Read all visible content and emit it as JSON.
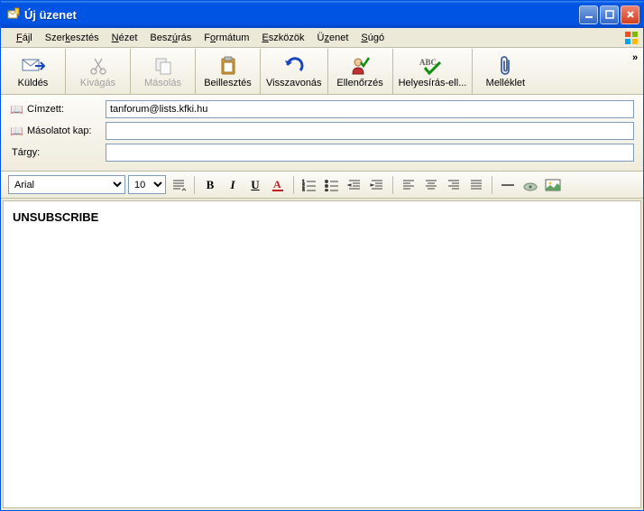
{
  "window": {
    "title": "Új üzenet"
  },
  "menu": {
    "items": [
      {
        "pre": "",
        "hot": "F",
        "post": "ájl"
      },
      {
        "pre": "Szer",
        "hot": "k",
        "post": "esztés"
      },
      {
        "pre": "",
        "hot": "N",
        "post": "ézet"
      },
      {
        "pre": "Besz",
        "hot": "ú",
        "post": "rás"
      },
      {
        "pre": "F",
        "hot": "o",
        "post": "rmátum"
      },
      {
        "pre": "",
        "hot": "E",
        "post": "szközök"
      },
      {
        "pre": "Ü",
        "hot": "z",
        "post": "enet"
      },
      {
        "pre": "",
        "hot": "S",
        "post": "úgó"
      }
    ]
  },
  "toolbar": {
    "send": "Küldés",
    "cut": "Kivágás",
    "copy": "Másolás",
    "paste": "Beillesztés",
    "undo": "Visszavonás",
    "check": "Ellenőrzés",
    "spell": "Helyesírás-ell...",
    "attach": "Melléklet",
    "overflow": "»"
  },
  "headers": {
    "to_label": "Címzett:",
    "to_value": "tanforum@lists.kfki.hu",
    "cc_label": "Másolatot kap:",
    "cc_value": "",
    "subject_label": "Tárgy:",
    "subject_value": ""
  },
  "format": {
    "font_name": "Arial",
    "font_size": "10"
  },
  "body": "UNSUBSCRIBE"
}
